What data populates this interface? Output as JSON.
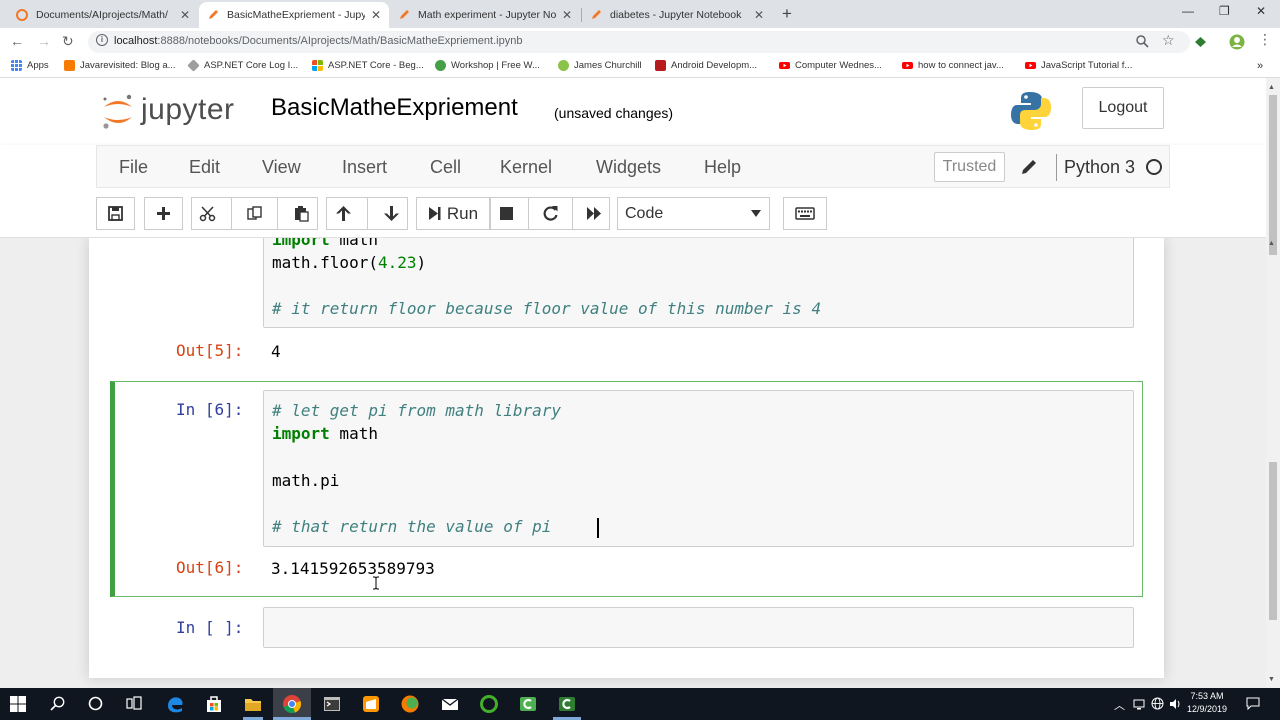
{
  "browser": {
    "tabs": [
      {
        "title": "Documents/AIprojects/Math/",
        "active": false
      },
      {
        "title": "BasicMatheExpriement - Jupyter Notebook",
        "active": true
      },
      {
        "title": "Math experiment - Jupyter Notebook",
        "active": false
      },
      {
        "title": "diabetes - Jupyter Notebook",
        "active": false
      }
    ],
    "new_tab": "+",
    "url_host": "localhost",
    "url_rest": ":8888/notebooks/Documents/AIprojects/Math/BasicMatheExpriement.ipynb",
    "bookmarks": [
      {
        "label": "Apps"
      },
      {
        "label": "Javarevisited: Blog a..."
      },
      {
        "label": "ASP.NET Core Log I..."
      },
      {
        "label": "ASP.NET Core - Beg..."
      },
      {
        "label": "Workshop | Free W..."
      },
      {
        "label": "James Churchill"
      },
      {
        "label": "Android Developm..."
      },
      {
        "label": "Computer Wednes..."
      },
      {
        "label": "how to connect jav..."
      },
      {
        "label": "JavaScript Tutorial f..."
      }
    ]
  },
  "jupyter": {
    "logo_text": "jupyter",
    "notebook_name": "BasicMatheExpriement",
    "save_status": "(unsaved changes)",
    "logout_label": "Logout",
    "menu": [
      "File",
      "Edit",
      "View",
      "Insert",
      "Cell",
      "Kernel",
      "Widgets",
      "Help"
    ],
    "trusted_label": "Trusted",
    "kernel_name": "Python 3",
    "run_label": "Run",
    "cell_type": "Code"
  },
  "cells": {
    "c5": {
      "line1_kw": "import",
      "line1_rest": " math",
      "line2_pre": "math.floor(",
      "line2_num": "4.23",
      "line2_post": ")",
      "line3": "# it return floor because floor value of this number is 4",
      "out_prompt": "Out[5]:",
      "out_value": "4"
    },
    "c6": {
      "in_prompt": "In [6]:",
      "line1": "# let get pi from math library",
      "line2_kw": "import",
      "line2_rest": " math",
      "line3": "math.pi",
      "line4": "# that return the value of pi",
      "out_prompt": "Out[6]:",
      "out_value": "3.141592653589793"
    },
    "c7": {
      "in_prompt": "In [ ]:"
    }
  },
  "taskbar": {
    "time": "7:53 AM",
    "date": "12/9/2019"
  }
}
